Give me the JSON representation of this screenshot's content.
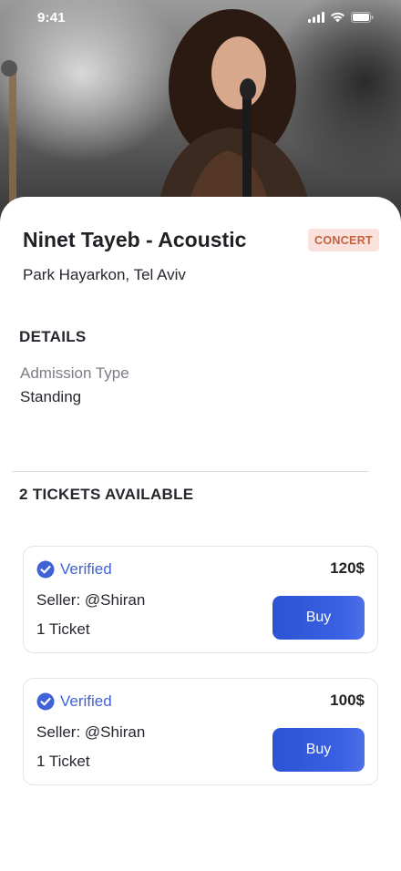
{
  "status_bar": {
    "time": "9:41"
  },
  "event": {
    "title": "Ninet Tayeb - Acoustic",
    "category": "CONCERT",
    "venue": "Park Hayarkon, Tel Aviv"
  },
  "details": {
    "heading": "DETAILS",
    "admission_label": "Admission Type",
    "admission_value": "Standing"
  },
  "tickets": {
    "heading": "2 TICKETS AVAILABLE",
    "items": [
      {
        "verified_label": "Verified",
        "price": "120$",
        "seller": "Seller: @Shiran",
        "quantity": "1 Ticket",
        "buy_label": "Buy"
      },
      {
        "verified_label": "Verified",
        "price": "100$",
        "seller": "Seller: @Shiran",
        "quantity": "1 Ticket",
        "buy_label": "Buy"
      }
    ]
  },
  "colors": {
    "accent": "#3f62d6",
    "badge_bg": "#fbe1dc",
    "badge_text": "#c2603f"
  },
  "icons": [
    "cellular-signal-icon",
    "wifi-icon",
    "battery-icon",
    "verified-check-icon"
  ]
}
